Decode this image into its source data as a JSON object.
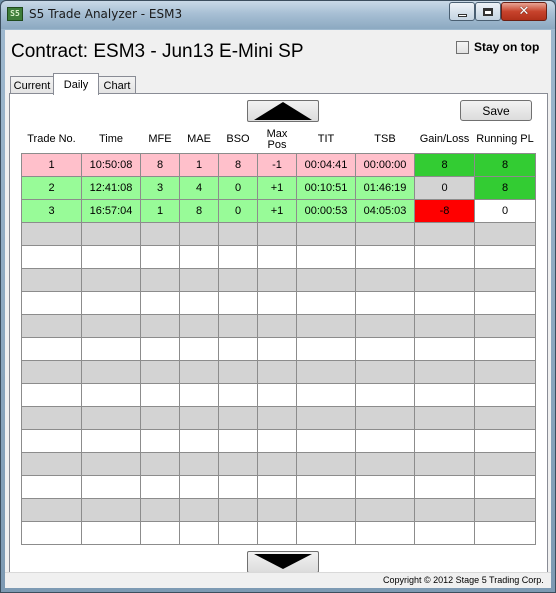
{
  "window": {
    "title": "S5 Trade Analyzer - ESM3",
    "icon": "s5-app-icon"
  },
  "header": {
    "contract_title": "Contract: ESM3 - Jun13 E-Mini SP",
    "stay_on_top_label": "Stay on top",
    "stay_on_top_checked": false
  },
  "tabs": [
    {
      "label": "Current"
    },
    {
      "label": "Daily"
    },
    {
      "label": "Chart"
    }
  ],
  "active_tab": "Daily",
  "toolbar": {
    "save_label": "Save",
    "scroll_up_icon": "triangle-up-icon",
    "scroll_down_icon": "triangle-down-icon"
  },
  "table": {
    "columns": [
      "Trade No.",
      "Time",
      "MFE",
      "MAE",
      "BSO",
      "Max\nPos",
      "TIT",
      "TSB",
      "Gain/Loss",
      "Running PL"
    ],
    "rows": [
      {
        "cells": [
          "1",
          "10:50:08",
          "8",
          "1",
          "8",
          "-1",
          "00:04:41",
          "00:00:00",
          "8",
          "8"
        ],
        "row_color": "#ffc0cb",
        "gain_color": "#33cc33",
        "pl_color": "#33cc33"
      },
      {
        "cells": [
          "2",
          "12:41:08",
          "3",
          "4",
          "0",
          "+1",
          "00:10:51",
          "01:46:19",
          "0",
          "8"
        ],
        "row_color": "#98fb98",
        "gain_color": "#d3d3d3",
        "pl_color": "#33cc33"
      },
      {
        "cells": [
          "3",
          "16:57:04",
          "1",
          "8",
          "0",
          "+1",
          "00:00:53",
          "04:05:03",
          "-8",
          "0"
        ],
        "row_color": "#98fb98",
        "gain_color": "#ff0000",
        "pl_color": "#ffffff"
      }
    ],
    "empty_row_count": 14
  },
  "footer": {
    "copyright": "Copyright © 2012 Stage 5 Trading Corp."
  }
}
